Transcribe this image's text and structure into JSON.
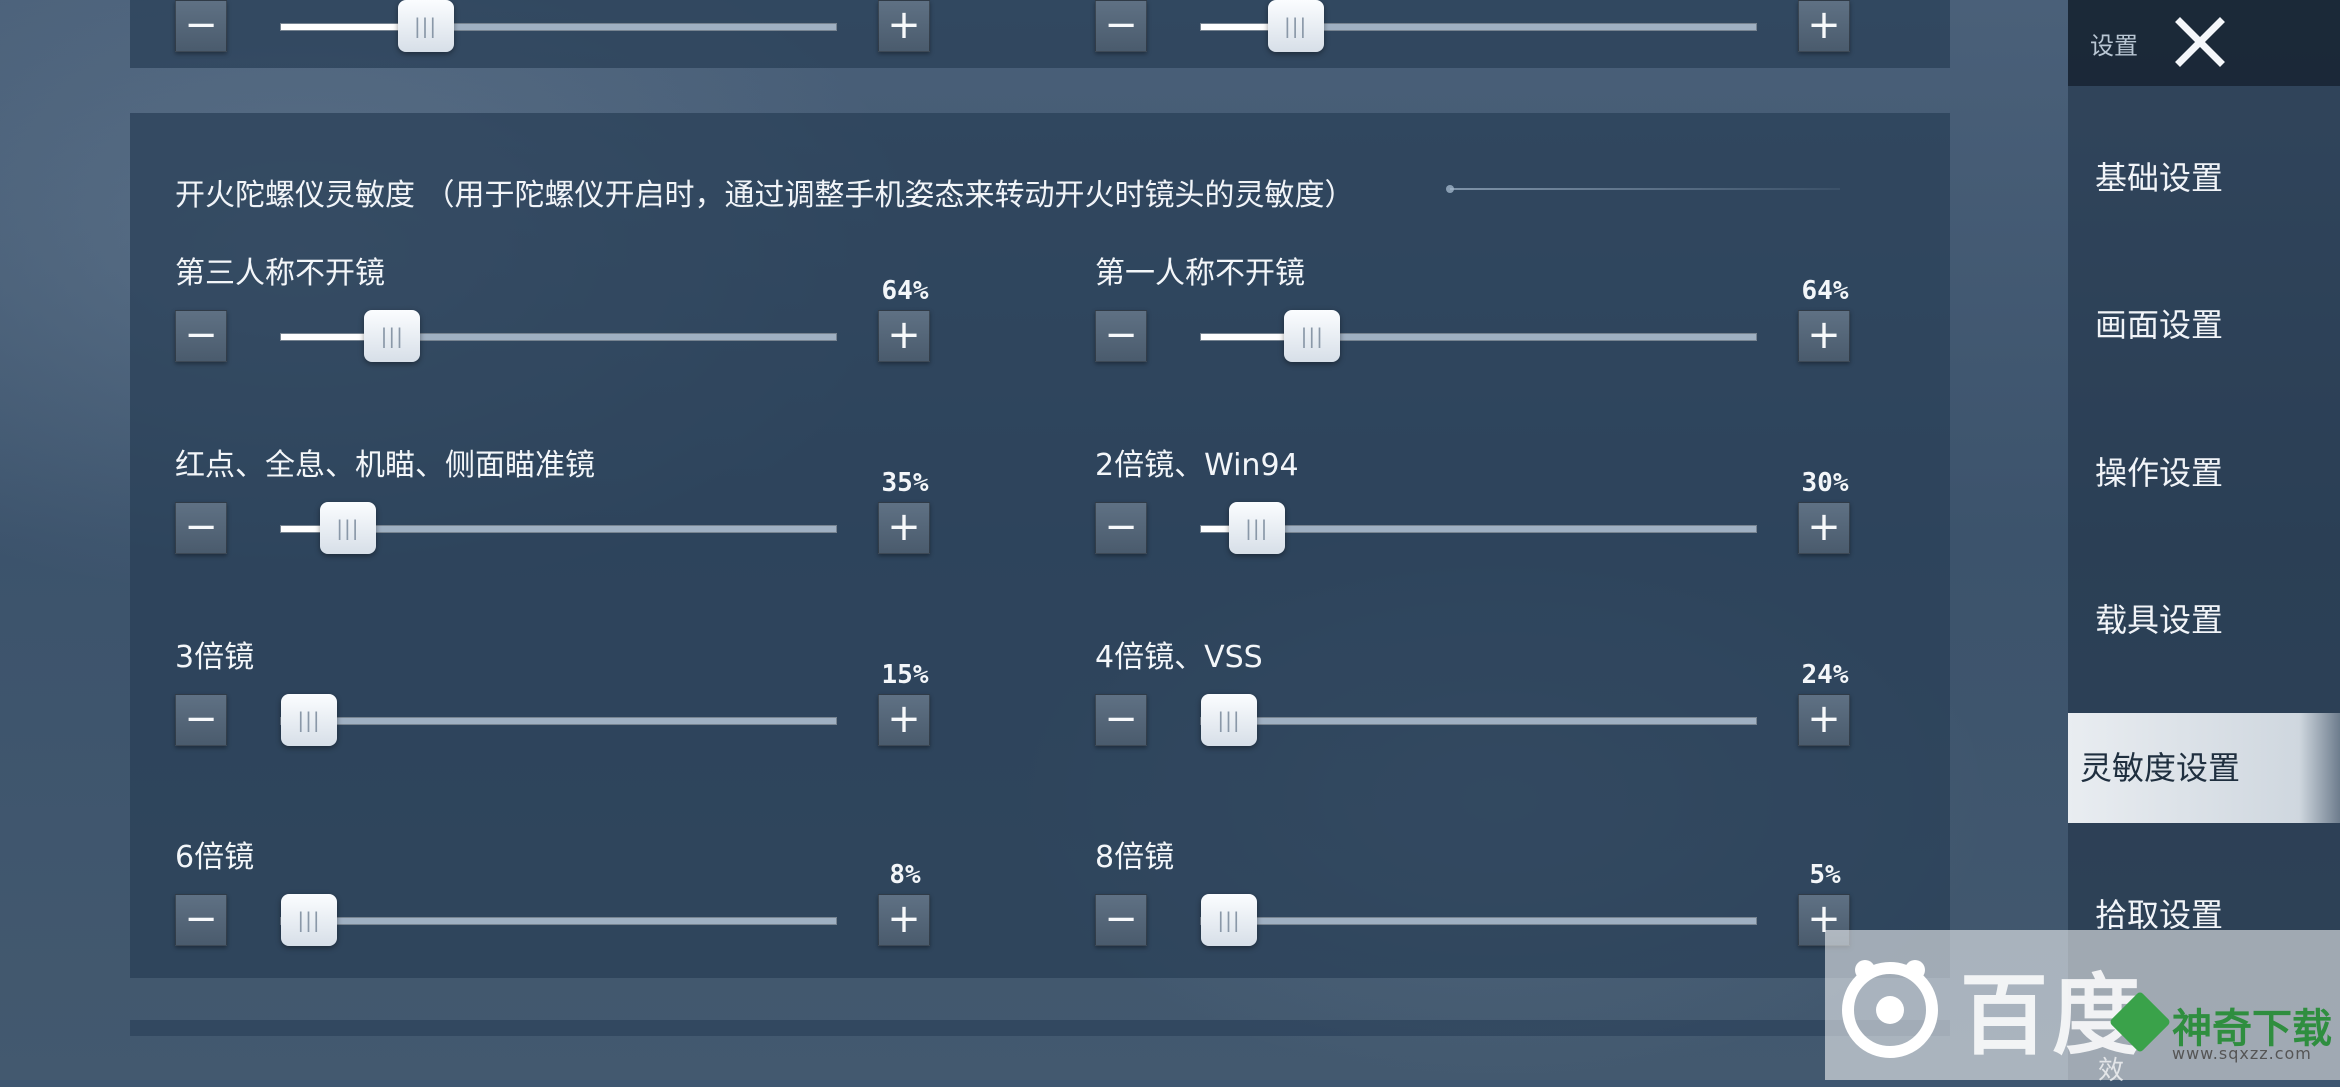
{
  "section": {
    "title": "开火陀螺仪灵敏度 （用于陀螺仪开启时，通过调整手机姿态来转动开火时镜头的灵敏度）"
  },
  "top_sliders": [
    {
      "value": 21
    },
    {
      "value": 12
    }
  ],
  "settings": [
    {
      "label": "第三人称不开镜",
      "value": "64%",
      "level": 0.15
    },
    {
      "label": "第一人称不开镜",
      "value": "64%",
      "level": 0.15
    },
    {
      "label": "红点、全息、机瞄、侧面瞄准镜",
      "value": "35%",
      "level": 0.07
    },
    {
      "label": "2倍镜、Win94",
      "value": "30%",
      "level": 0.05
    },
    {
      "label": "3倍镜",
      "value": "15%",
      "level": 0.0
    },
    {
      "label": "4倍镜、VSS",
      "value": "24%",
      "level": 0.0
    },
    {
      "label": "6倍镜",
      "value": "8%",
      "level": 0.0
    },
    {
      "label": "8倍镜",
      "value": "5%",
      "level": 0.0
    }
  ],
  "controls": {
    "minus": "−",
    "plus": "+",
    "thumb_grip": "|||"
  },
  "nav": {
    "header": "设置",
    "items": [
      "基础设置",
      "画面设置",
      "操作设置",
      "载具设置",
      "灵敏度设置",
      "拾取设置"
    ],
    "active_index": 4
  },
  "watermark": {
    "text": "百度",
    "brand": "神奇下载",
    "url": "www.sqxzz.com",
    "corner": "效"
  }
}
